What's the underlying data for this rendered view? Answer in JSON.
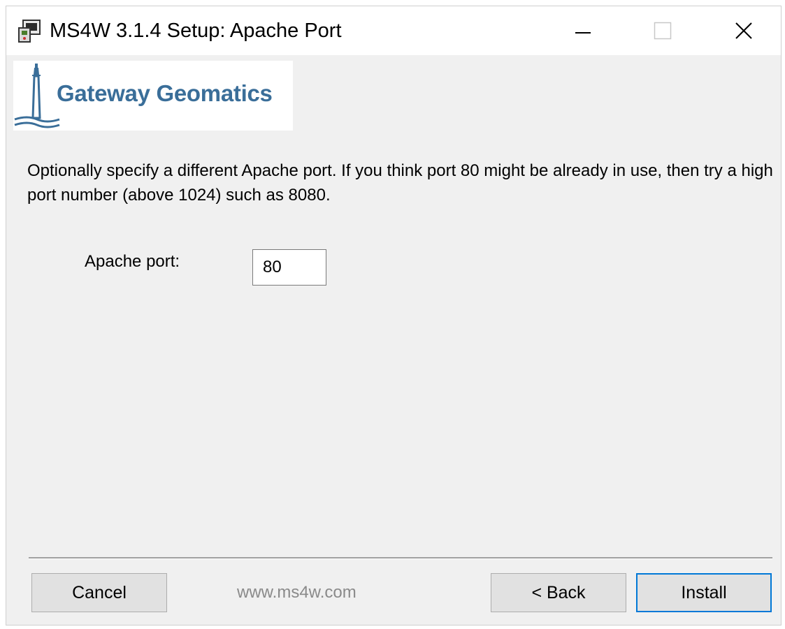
{
  "window": {
    "title": "MS4W 3.1.4 Setup: Apache Port",
    "icon": "installer-icon"
  },
  "logo": {
    "text": "Gateway Geomatics",
    "color": "#3a6e99"
  },
  "description": "Optionally specify a different Apache port.  If you think port 80 might be already in use, then try a high port number (above 1024) such as 8080.",
  "form": {
    "port_label": "Apache port:",
    "port_value": "80"
  },
  "footer": {
    "cancel_label": "Cancel",
    "site": "www.ms4w.com",
    "back_label": "< Back",
    "install_label": "Install",
    "default_button_color": "#0078d7"
  }
}
